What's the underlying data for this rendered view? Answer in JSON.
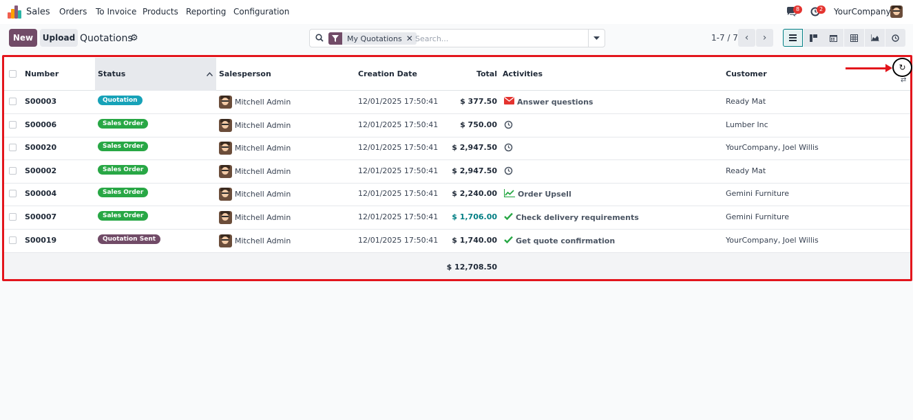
{
  "nav": {
    "app_name": "Sales",
    "menu": [
      "Orders",
      "To Invoice",
      "Products",
      "Reporting",
      "Configuration"
    ],
    "messages_count": "8",
    "activities_count": "2",
    "company": "YourCompany"
  },
  "control": {
    "new_label": "New",
    "upload_label": "Upload",
    "breadcrumb": "Quotations",
    "facet_label": "My Quotations",
    "search_placeholder": "Search...",
    "pager": "1-7 / 7"
  },
  "table": {
    "columns": {
      "number": "Number",
      "status": "Status",
      "salesperson": "Salesperson",
      "creation_date": "Creation Date",
      "total": "Total",
      "activities": "Activities",
      "customer": "Customer"
    },
    "rows": [
      {
        "number": "S00003",
        "status": "Quotation",
        "salesperson": "Mitchell Admin",
        "date": "12/01/2025 17:50:41",
        "total": "$ 377.50",
        "activity": "Answer questions",
        "customer": "Ready Mat"
      },
      {
        "number": "S00006",
        "status": "Sales Order",
        "salesperson": "Mitchell Admin",
        "date": "12/01/2025 17:50:41",
        "total": "$ 750.00",
        "activity": "",
        "customer": "Lumber Inc"
      },
      {
        "number": "S00020",
        "status": "Sales Order",
        "salesperson": "Mitchell Admin",
        "date": "12/01/2025 17:50:41",
        "total": "$ 2,947.50",
        "activity": "",
        "customer": "YourCompany, Joel Willis"
      },
      {
        "number": "S00002",
        "status": "Sales Order",
        "salesperson": "Mitchell Admin",
        "date": "12/01/2025 17:50:41",
        "total": "$ 2,947.50",
        "activity": "",
        "customer": "Ready Mat"
      },
      {
        "number": "S00004",
        "status": "Sales Order",
        "salesperson": "Mitchell Admin",
        "date": "12/01/2025 17:50:41",
        "total": "$ 2,240.00",
        "activity": "Order Upsell",
        "customer": "Gemini Furniture"
      },
      {
        "number": "S00007",
        "status": "Sales Order",
        "salesperson": "Mitchell Admin",
        "date": "12/01/2025 17:50:41",
        "total": "$ 1,706.00",
        "activity": "Check delivery requirements",
        "customer": "Gemini Furniture"
      },
      {
        "number": "S00019",
        "status": "Quotation Sent",
        "salesperson": "Mitchell Admin",
        "date": "12/01/2025 17:50:41",
        "total": "$ 1,740.00",
        "activity": "Get quote confirmation",
        "customer": "YourCompany, Joel Willis"
      }
    ],
    "grand_total": "$ 12,708.50"
  },
  "colors": {
    "brand": "#714b67",
    "quotation": "#17a2b8",
    "sales_order": "#28a745",
    "quotation_sent": "#714b67",
    "highlight": "#e3141b",
    "total_link": "#017e84"
  },
  "icons": {
    "refresh": "refresh-icon",
    "arrow": "red-arrow-annotation"
  }
}
